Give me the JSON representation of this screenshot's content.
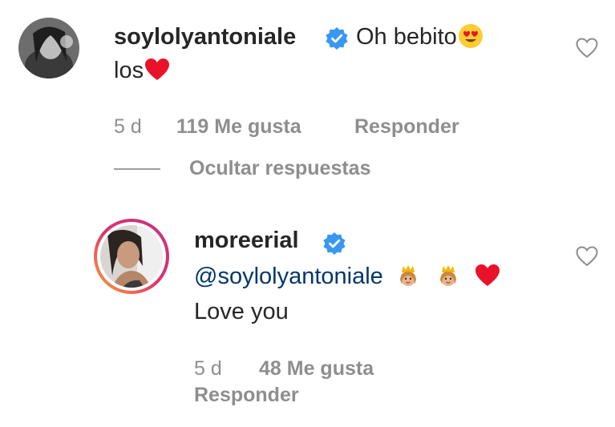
{
  "comment": {
    "username": "soylolyantoniale",
    "text_part1": "Oh bebito",
    "text_part2": "los",
    "time": "5 d",
    "likes": "119 Me gusta",
    "reply_label": "Responder",
    "hide_replies_label": "Ocultar respuestas"
  },
  "reply": {
    "username": "moreerial",
    "mention": "@soylolyantoniale",
    "text": "Love you",
    "time": "5 d",
    "likes": "48 Me gusta",
    "reply_label": "Responder"
  },
  "icons": {
    "verified": "verified-badge-icon",
    "like": "heart-outline-icon",
    "emoji_heart_eyes": "heart-eyes-emoji",
    "emoji_heart": "red-heart-emoji",
    "emoji_princess": "princess-emoji"
  },
  "colors": {
    "verified_blue": "#3897f0",
    "mention": "#00376b",
    "muted": "#8e8e8e",
    "heart_red": "#e8132b"
  }
}
